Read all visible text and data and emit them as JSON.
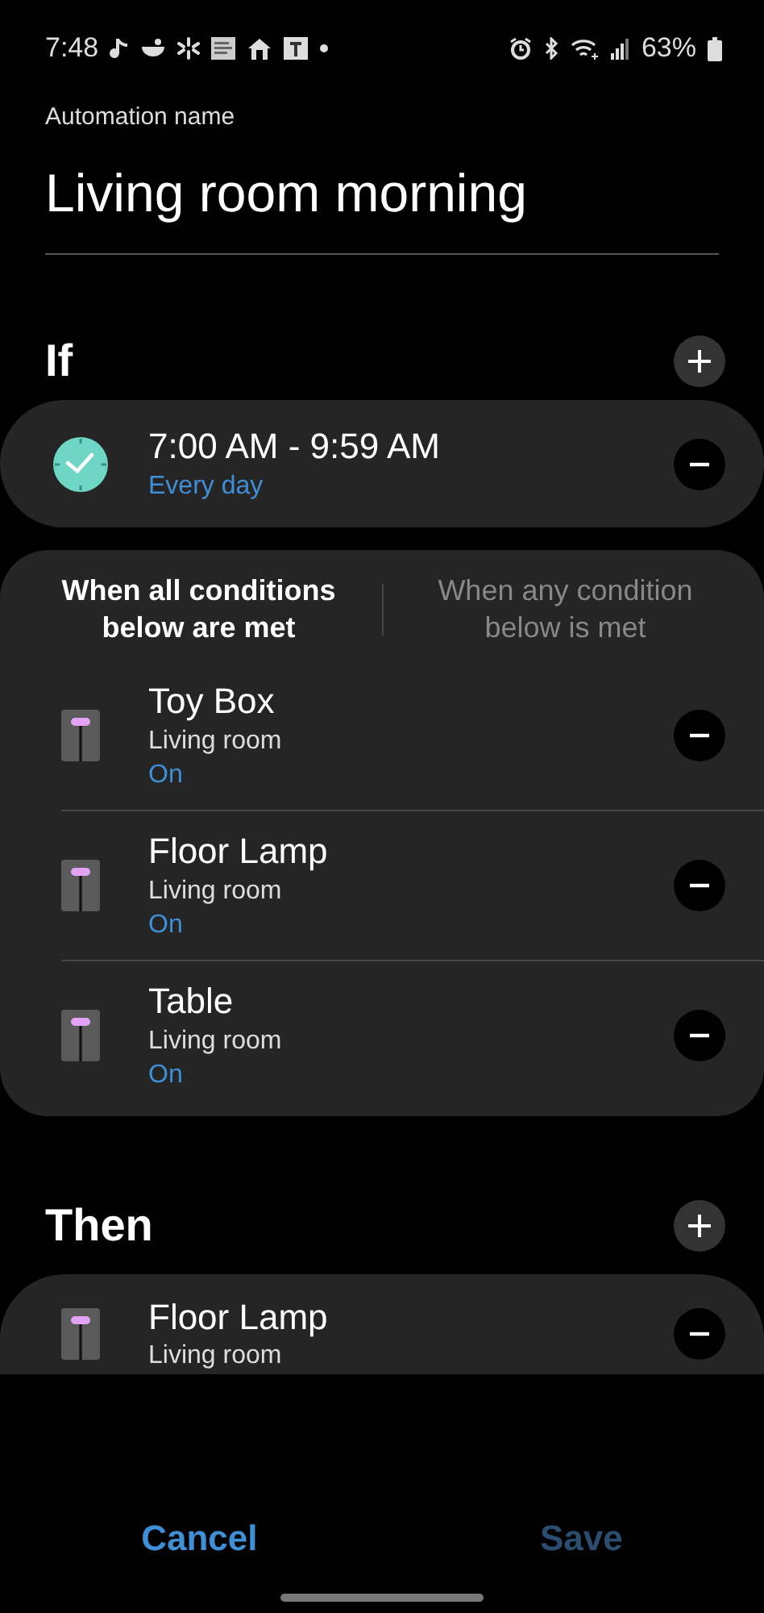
{
  "status_bar": {
    "time": "7:48",
    "battery": "63%"
  },
  "header": {
    "label": "Automation name",
    "name": "Living room morning"
  },
  "if_section": {
    "title": "If",
    "time_condition": {
      "range": "7:00 AM - 9:59 AM",
      "repeat": "Every day"
    },
    "match_modes": [
      {
        "label": "When all conditions below are met",
        "selected": true
      },
      {
        "label": "When any condition below is met",
        "selected": false
      }
    ],
    "conditions": [
      {
        "name": "Toy Box",
        "room": "Living room",
        "state": "On"
      },
      {
        "name": "Floor Lamp",
        "room": "Living room",
        "state": "On"
      },
      {
        "name": "Table",
        "room": "Living room",
        "state": "On"
      }
    ]
  },
  "then_section": {
    "title": "Then",
    "actions": [
      {
        "name": "Floor Lamp",
        "room": "Living room"
      }
    ]
  },
  "footer": [
    {
      "label": "Cancel",
      "disabled": false
    },
    {
      "label": "Save",
      "disabled": true
    }
  ]
}
